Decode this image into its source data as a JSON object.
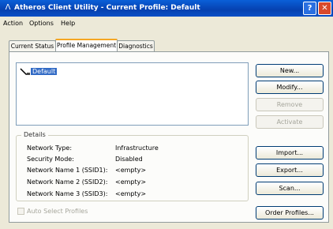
{
  "window": {
    "title": "Atheros Client Utility - Current Profile: Default",
    "help_glyph": "?",
    "close_glyph": "✕"
  },
  "menu": [
    "Action",
    "Options",
    "Help"
  ],
  "tabs": [
    {
      "label": "Current Status",
      "active": false
    },
    {
      "label": "Profile Management",
      "active": true
    },
    {
      "label": "Diagnostics",
      "active": false
    }
  ],
  "profiles": [
    {
      "name": "Default",
      "selected": true
    }
  ],
  "buttons": {
    "new": "New...",
    "modify": "Modify...",
    "remove": "Remove",
    "activate": "Activate",
    "import": "Import...",
    "export": "Export...",
    "scan": "Scan...",
    "order_profiles": "Order Profiles..."
  },
  "button_states": {
    "remove_enabled": false,
    "activate_enabled": false
  },
  "details": {
    "legend": "Details",
    "rows": [
      {
        "label": "Network Type:",
        "value": "Infrastructure"
      },
      {
        "label": "Security Mode:",
        "value": "Disabled"
      },
      {
        "label": "Network Name 1 (SSID1):",
        "value": "<empty>"
      },
      {
        "label": "Network Name 2 (SSID2):",
        "value": "<empty>"
      },
      {
        "label": "Network Name 3 (SSID3):",
        "value": "<empty>"
      }
    ]
  },
  "auto_select": {
    "label": "Auto Select Profiles",
    "checked": false,
    "enabled": false
  },
  "colors": {
    "title_bar": "#0a4fc6",
    "selection": "#316ac5",
    "window_bg": "#ece9d8"
  }
}
